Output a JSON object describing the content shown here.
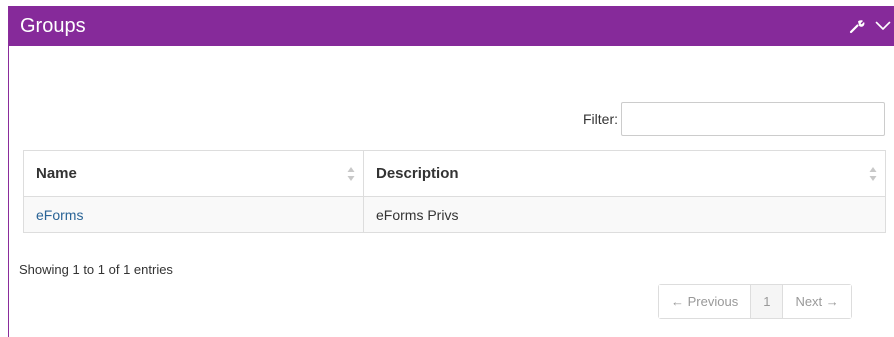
{
  "panel": {
    "title": "Groups",
    "header_bg": "#862a9a",
    "icons": [
      "wrench-icon",
      "chevron-down-icon"
    ]
  },
  "filter": {
    "label": "Filter:",
    "value": ""
  },
  "table": {
    "columns": [
      "Name",
      "Description"
    ],
    "rows": [
      {
        "name": "eForms",
        "description": "eForms Privs"
      }
    ]
  },
  "info_text": "Showing 1 to 1 of 1 entries",
  "pagination": {
    "previous": "← Previous",
    "current_page": "1",
    "next": "Next →"
  }
}
